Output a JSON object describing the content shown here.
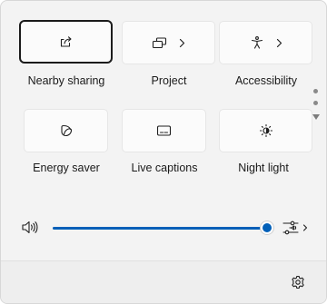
{
  "quick_settings": {
    "tiles": [
      {
        "label": "Nearby sharing",
        "icon": "share-icon",
        "has_chevron": false,
        "focused": true
      },
      {
        "label": "Project",
        "icon": "project-icon",
        "has_chevron": true,
        "focused": false
      },
      {
        "label": "Accessibility",
        "icon": "accessibility-icon",
        "has_chevron": true,
        "focused": false
      },
      {
        "label": "Energy saver",
        "icon": "leaf-icon",
        "has_chevron": false,
        "focused": false
      },
      {
        "label": "Live captions",
        "icon": "captions-icon",
        "has_chevron": false,
        "focused": false
      },
      {
        "label": "Night light",
        "icon": "brightness-icon",
        "has_chevron": false,
        "focused": false
      }
    ],
    "pagination": {
      "pages": 2,
      "current": 1
    }
  },
  "volume": {
    "level": 100,
    "icon": "speaker-icon",
    "output_icon": "audio-output-icon"
  },
  "footer": {
    "settings_icon": "gear-icon"
  },
  "colors": {
    "accent": "#005fb8",
    "panel_bg": "#f3f3f3",
    "tile_bg": "#fbfbfb",
    "footer_bg": "#eeeeee"
  }
}
